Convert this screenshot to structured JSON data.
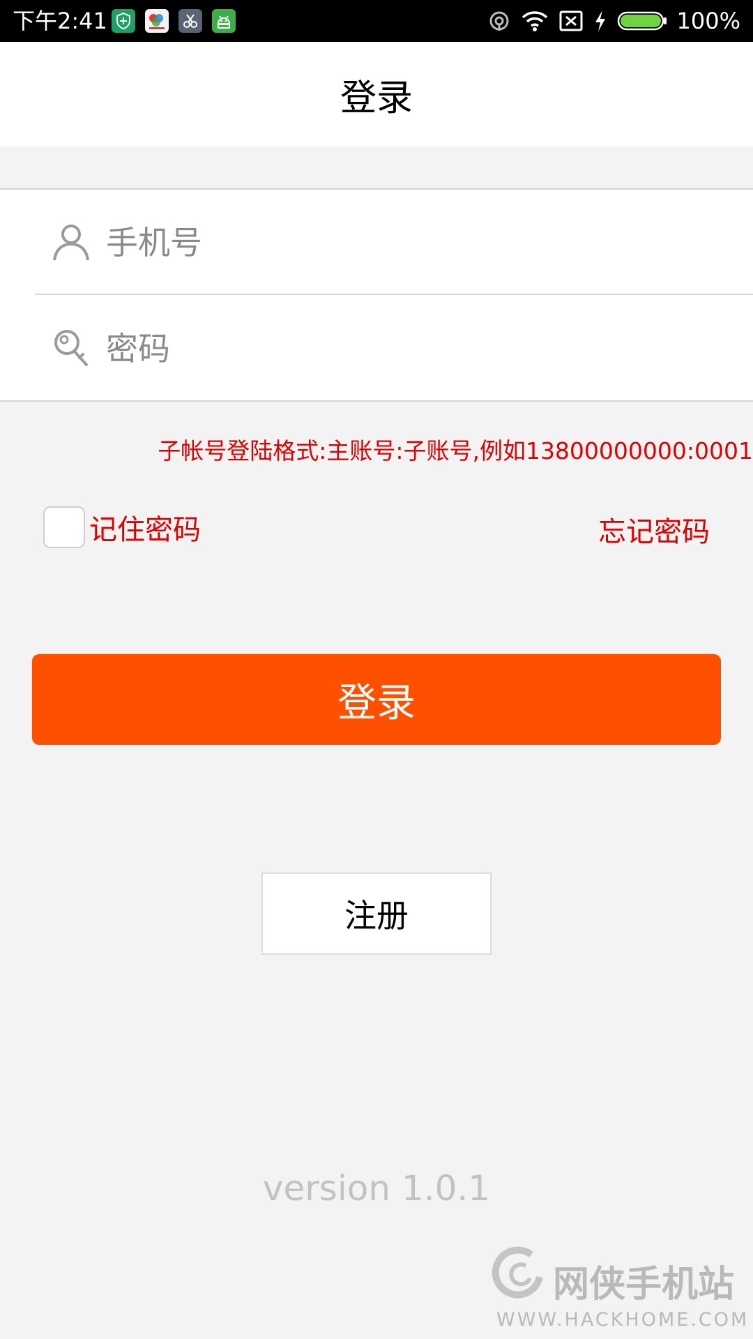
{
  "status_bar": {
    "time": "下午2:41",
    "battery_percent": "100%",
    "notification_icons": [
      "shield-app-icon",
      "colorful-app-icon",
      "scissors-app-icon",
      "android-app-icon"
    ],
    "system_icons": [
      "hotspot-icon",
      "wifi-icon",
      "no-sim-icon",
      "charging-icon",
      "battery-icon"
    ]
  },
  "header": {
    "title": "登录"
  },
  "form": {
    "phone": {
      "placeholder": "手机号",
      "value": "",
      "icon": "user-icon"
    },
    "password": {
      "placeholder": "密码",
      "value": "",
      "icon": "key-icon"
    }
  },
  "hint": "子帐号登陆格式:主账号:子账号,例如13800000000:0001",
  "remember": {
    "label": "记住密码",
    "checked": false
  },
  "forgot_label": "忘记密码",
  "login_button": "登录",
  "register_button": "注册",
  "version": "version 1.0.1",
  "watermark": {
    "name": "网侠手机站",
    "url": "WWW.HACKHOME.COM"
  },
  "colors": {
    "accent": "#ff5000",
    "hint_red": "#e00000",
    "background": "#f3f3f3",
    "status_bar": "#000000",
    "battery_green": "#6fd43f"
  }
}
